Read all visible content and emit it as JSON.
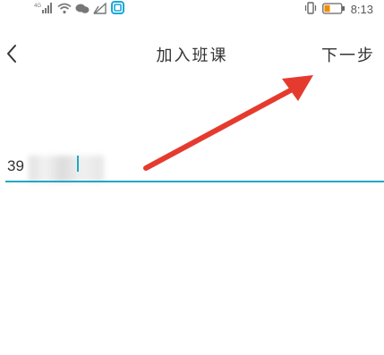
{
  "status_bar": {
    "time": "8:13",
    "signal_label": "4G",
    "icons": [
      "signal-bars-icon",
      "wifi-icon",
      "chat-bubble-icon",
      "cell-signal-icon",
      "notification-square-icon",
      "vibrate-icon",
      "battery-low-icon"
    ],
    "battery_color": "#f28c00"
  },
  "nav": {
    "back_icon": "chevron-left-icon",
    "title": "加入班课",
    "next_label": "下一步"
  },
  "form": {
    "code_value": "39",
    "accent_color": "#22a7c7"
  },
  "annotation": {
    "arrow_color": "#e53b2f",
    "points_to": "next-button"
  }
}
